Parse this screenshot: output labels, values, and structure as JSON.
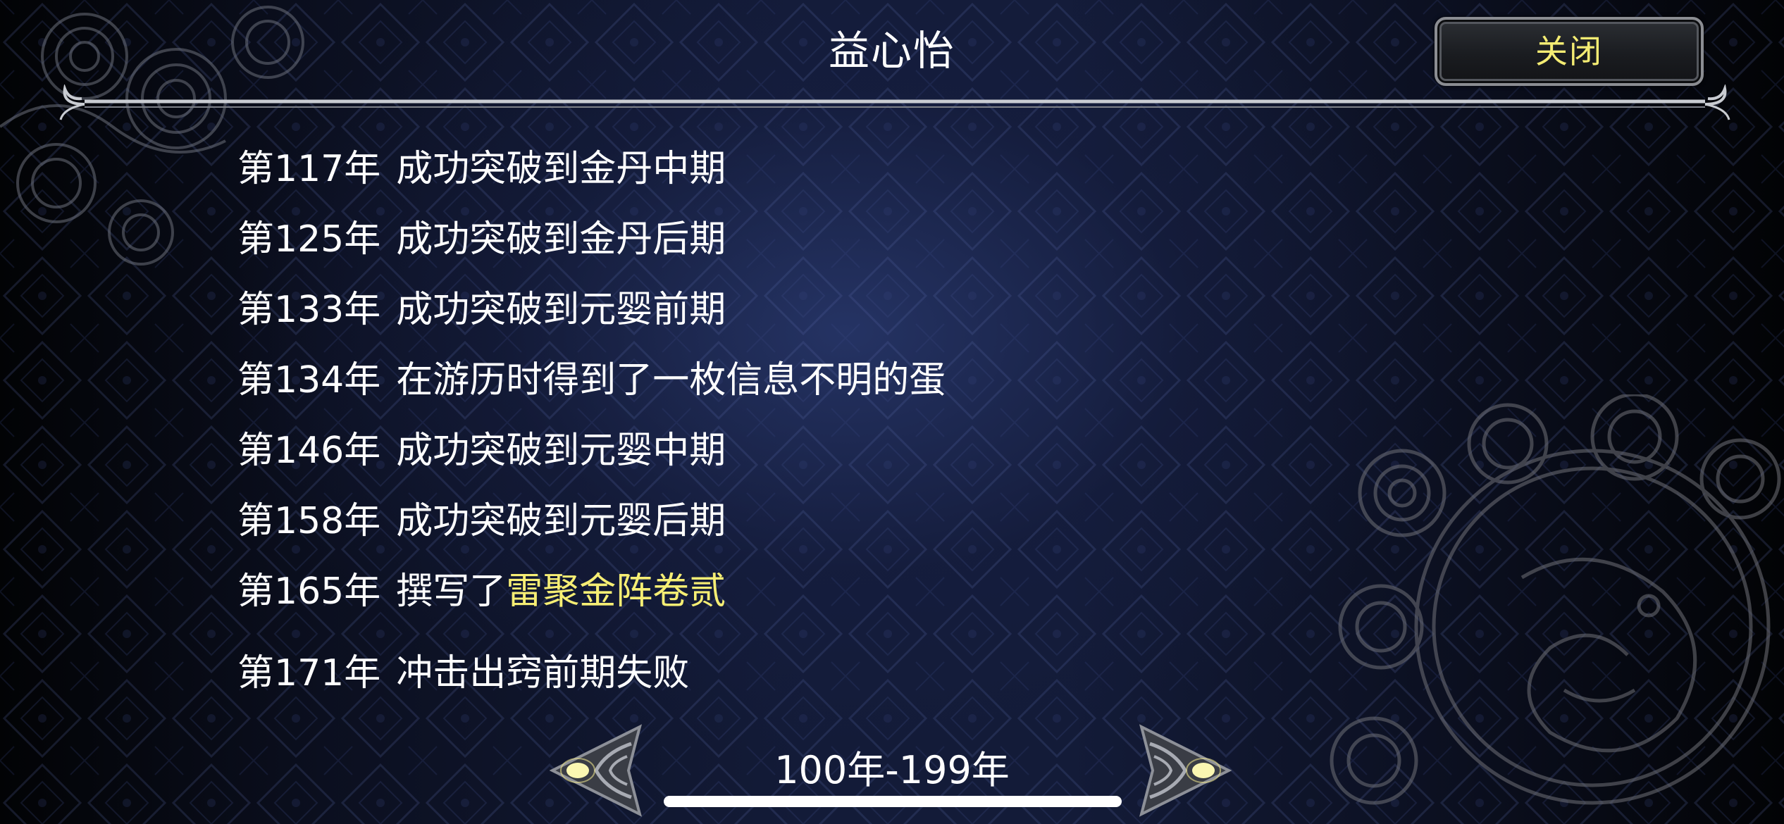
{
  "window": {
    "title": "益心怡",
    "close_label": "关闭"
  },
  "events": [
    {
      "year": "第117年",
      "text": "成功突破到金丹中期",
      "highlight": ""
    },
    {
      "year": "第125年",
      "text": "成功突破到金丹后期",
      "highlight": ""
    },
    {
      "year": "第133年",
      "text": "成功突破到元婴前期",
      "highlight": ""
    },
    {
      "year": "第134年",
      "text": "在游历时得到了一枚信息不明的蛋",
      "highlight": ""
    },
    {
      "year": "第146年",
      "text": "成功突破到元婴中期",
      "highlight": ""
    },
    {
      "year": "第158年",
      "text": "成功突破到元婴后期",
      "highlight": ""
    },
    {
      "year": "第165年",
      "text": "撰写了",
      "highlight": "雷聚金阵卷贰"
    },
    {
      "year": "第171年",
      "text": "冲击出窍前期失败",
      "highlight": ""
    }
  ],
  "pagination": {
    "range_label": "100年-199年",
    "prev_icon": "left-arrow-icon",
    "next_icon": "right-arrow-icon"
  },
  "colors": {
    "text": "#ffffff",
    "highlight": "#f6ee74",
    "button_text": "#f4ec73",
    "background": "#131b38"
  }
}
